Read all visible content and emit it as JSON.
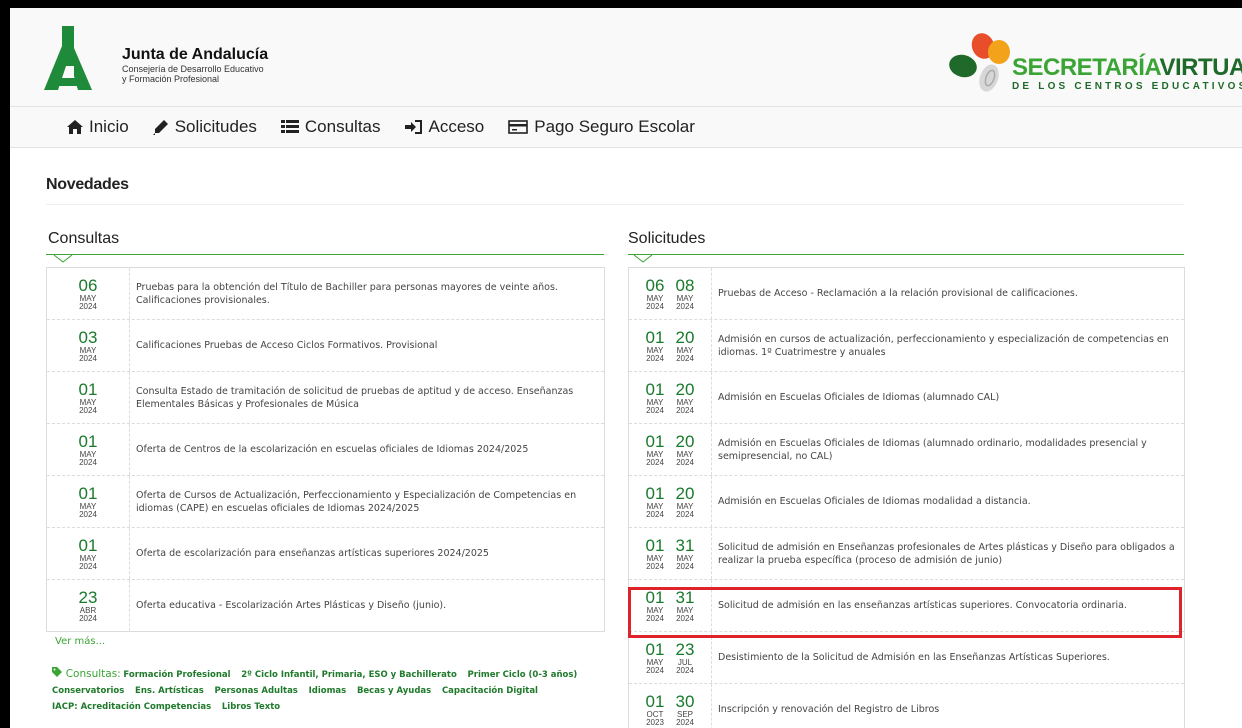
{
  "header": {
    "brand_title": "Junta de Andalucía",
    "brand_sub1": "Consejería de Desarrollo Educativo",
    "brand_sub2": "y Formación Profesional",
    "sv_word1": "SECRETARÍA",
    "sv_word2": "VIRTUAL",
    "sv_subtitle": "DE LOS CENTROS EDUCATIVOS"
  },
  "nav": {
    "items": [
      {
        "label": "Inicio",
        "icon": "home-icon"
      },
      {
        "label": "Solicitudes",
        "icon": "pencil-icon"
      },
      {
        "label": "Consultas",
        "icon": "list-icon"
      },
      {
        "label": "Acceso",
        "icon": "sign-in-icon"
      },
      {
        "label": "Pago Seguro Escolar",
        "icon": "credit-card-icon"
      }
    ]
  },
  "main": {
    "heading": "Novedades",
    "consultas": {
      "title": "Consultas",
      "items": [
        {
          "d": "06",
          "m": "MAY",
          "y": "2024",
          "text": "Pruebas para la obtención del Título de Bachiller para personas mayores de veinte años. Calificaciones provisionales."
        },
        {
          "d": "03",
          "m": "MAY",
          "y": "2024",
          "text": "Calificaciones Pruebas de Acceso Ciclos Formativos. Provisional"
        },
        {
          "d": "01",
          "m": "MAY",
          "y": "2024",
          "text": "Consulta Estado de tramitación de solicitud de pruebas de aptitud y de acceso. Enseñanzas Elementales Básicas y Profesionales de Música"
        },
        {
          "d": "01",
          "m": "MAY",
          "y": "2024",
          "text": "Oferta de Centros de la escolarización en escuelas oficiales de Idiomas 2024/2025"
        },
        {
          "d": "01",
          "m": "MAY",
          "y": "2024",
          "text": "Oferta de Cursos de Actualización, Perfeccionamiento y Especialización de Competencias en idiomas (CAPE) en escuelas oficiales de Idiomas 2024/2025"
        },
        {
          "d": "01",
          "m": "MAY",
          "y": "2024",
          "text": "Oferta de escolarización para enseñanzas artísticas superiores 2024/2025"
        },
        {
          "d": "23",
          "m": "ABR",
          "y": "2024",
          "text": "Oferta educativa - Escolarización Artes Plásticas y Diseño (junio)."
        }
      ],
      "ver_mas": "Ver más...",
      "tags_label": "Consultas:",
      "tags": [
        "Formación Profesional",
        "2º Ciclo Infantil, Primaria, ESO y Bachillerato",
        "Primer Ciclo (0-3 años)",
        "Conservatorios",
        "Ens. Artísticas",
        "Personas Adultas",
        "Idiomas",
        "Becas y Ayudas",
        "Capacitación Digital",
        "IACP: Acreditación Competencias",
        "Libros Texto"
      ]
    },
    "solicitudes": {
      "title": "Solicitudes",
      "items": [
        {
          "d1": "06",
          "m1": "MAY",
          "y1": "2024",
          "d2": "08",
          "m2": "MAY",
          "y2": "2024",
          "text": "Pruebas de Acceso - Reclamación a la relación provisional de calificaciones."
        },
        {
          "d1": "01",
          "m1": "MAY",
          "y1": "2024",
          "d2": "20",
          "m2": "MAY",
          "y2": "2024",
          "text": "Admisión en cursos de actualización, perfeccionamiento y especialización de competencias en idiomas. 1º Cuatrimestre y anuales"
        },
        {
          "d1": "01",
          "m1": "MAY",
          "y1": "2024",
          "d2": "20",
          "m2": "MAY",
          "y2": "2024",
          "text": "Admisión en Escuelas Oficiales de Idiomas (alumnado CAL)"
        },
        {
          "d1": "01",
          "m1": "MAY",
          "y1": "2024",
          "d2": "20",
          "m2": "MAY",
          "y2": "2024",
          "text": "Admisión en Escuelas Oficiales de Idiomas (alumnado ordinario, modalidades presencial y semipresencial, no CAL)"
        },
        {
          "d1": "01",
          "m1": "MAY",
          "y1": "2024",
          "d2": "20",
          "m2": "MAY",
          "y2": "2024",
          "text": "Admisión en Escuelas Oficiales de Idiomas modalidad a distancia."
        },
        {
          "d1": "01",
          "m1": "MAY",
          "y1": "2024",
          "d2": "31",
          "m2": "MAY",
          "y2": "2024",
          "text": "Solicitud de admisión en Enseñanzas profesionales de Artes plásticas y Diseño para obligados a realizar la prueba específica (proceso de admisión de junio)"
        },
        {
          "d1": "01",
          "m1": "MAY",
          "y1": "2024",
          "d2": "31",
          "m2": "MAY",
          "y2": "2024",
          "text": "Solicitud de admisión en las enseñanzas artísticas superiores. Convocatoria ordinaria."
        },
        {
          "d1": "01",
          "m1": "MAY",
          "y1": "2024",
          "d2": "23",
          "m2": "JUL",
          "y2": "2024",
          "text": "Desistimiento de la Solicitud de Admisión en las Enseñanzas Artísticas Superiores."
        },
        {
          "d1": "01",
          "m1": "OCT",
          "y1": "2023",
          "d2": "30",
          "m2": "SEP",
          "y2": "2024",
          "text": "Inscripción y renovación del Registro de Libros"
        }
      ]
    }
  },
  "colors": {
    "accent": "#3aa535",
    "accent_dark": "#1f6a2a",
    "highlight": "#e0222a"
  }
}
